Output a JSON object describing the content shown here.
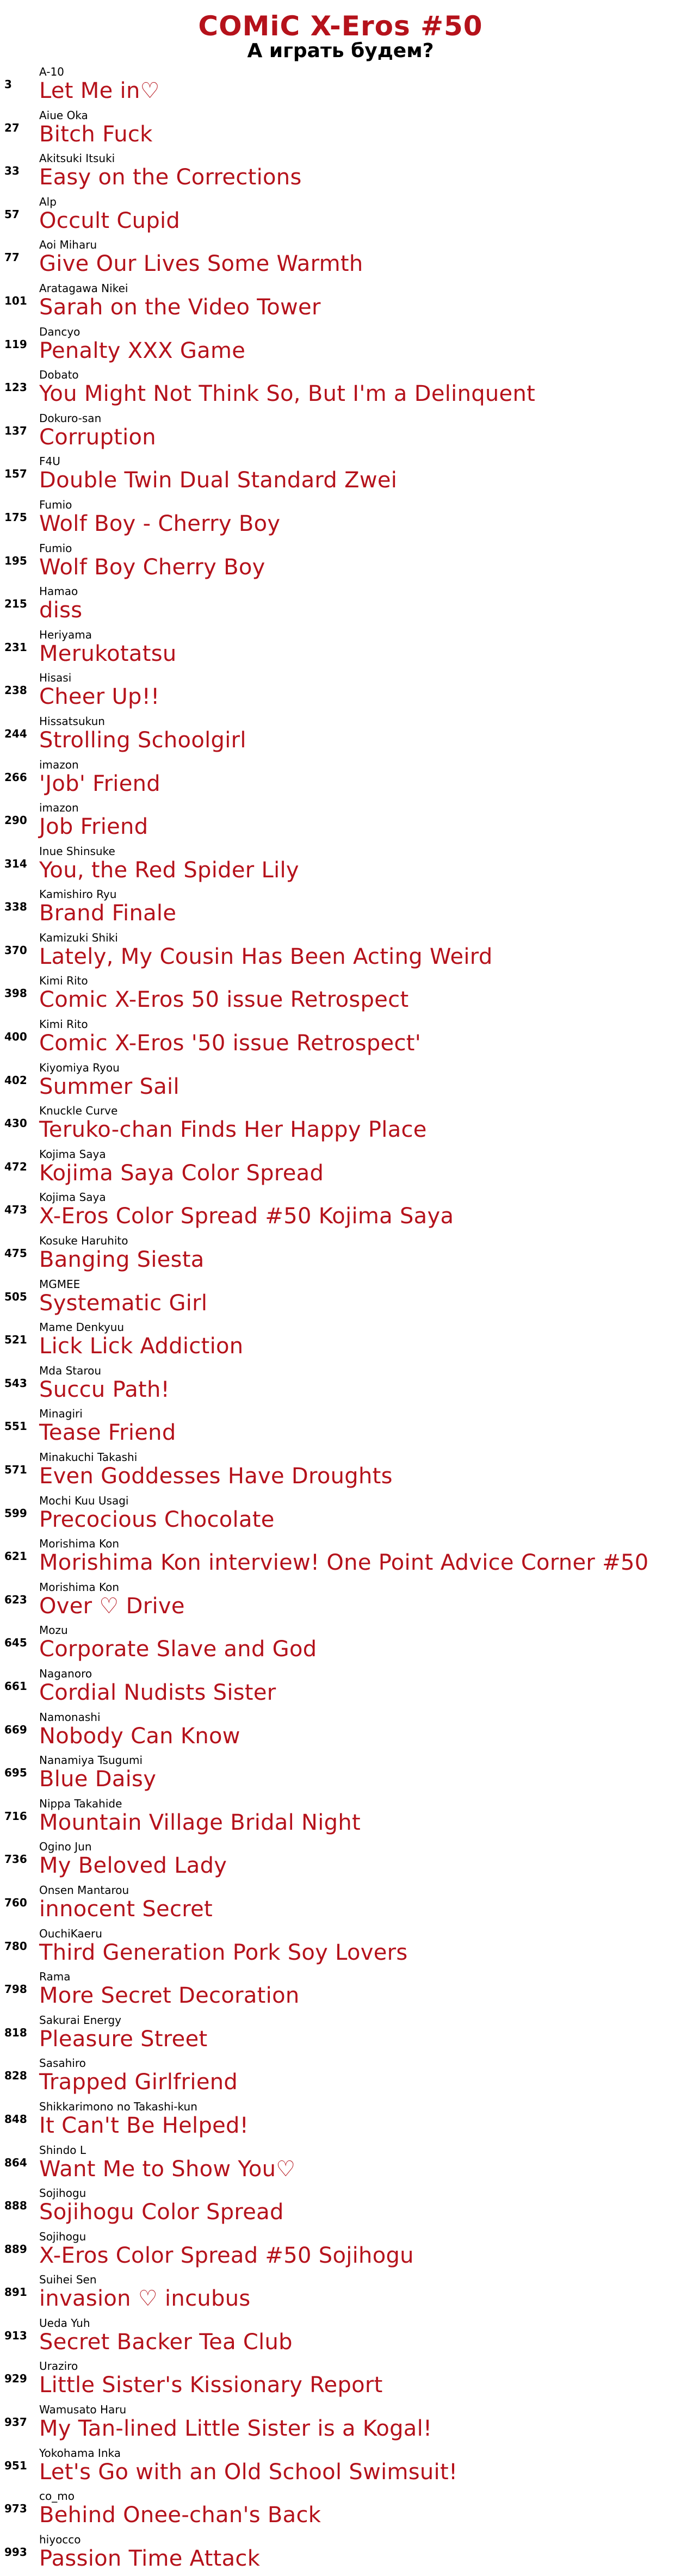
{
  "header": {
    "title": "COMiC X-Eros #50",
    "subtitle": "А играть будем?"
  },
  "colors": {
    "accent": "#b5121b",
    "text": "#000000",
    "background": "#ffffff"
  },
  "entries": [
    {
      "page": "3",
      "author": "A-10",
      "title": "Let Me in♡"
    },
    {
      "page": "27",
      "author": "Aiue Oka",
      "title": "Bitch Fuck"
    },
    {
      "page": "33",
      "author": "Akitsuki Itsuki",
      "title": "Easy on the Corrections"
    },
    {
      "page": "57",
      "author": "Alp",
      "title": "Occult Cupid"
    },
    {
      "page": "77",
      "author": "Aoi Miharu",
      "title": "Give Our Lives Some Warmth"
    },
    {
      "page": "101",
      "author": "Aratagawa Nikei",
      "title": "Sarah on the Video Tower"
    },
    {
      "page": "119",
      "author": "Dancyo",
      "title": "Penalty XXX Game"
    },
    {
      "page": "123",
      "author": "Dobato",
      "title": "You Might Not Think So, But I'm a Delinquent"
    },
    {
      "page": "137",
      "author": "Dokuro-san",
      "title": "Corruption"
    },
    {
      "page": "157",
      "author": "F4U",
      "title": "Double Twin Dual Standard Zwei"
    },
    {
      "page": "175",
      "author": "Fumio",
      "title": "Wolf Boy - Cherry Boy"
    },
    {
      "page": "195",
      "author": "Fumio",
      "title": "Wolf Boy Cherry Boy"
    },
    {
      "page": "215",
      "author": "Hamao",
      "title": "diss"
    },
    {
      "page": "231",
      "author": "Heriyama",
      "title": "Merukotatsu"
    },
    {
      "page": "238",
      "author": "Hisasi",
      "title": "Cheer Up!!"
    },
    {
      "page": "244",
      "author": "Hissatsukun",
      "title": "Strolling Schoolgirl"
    },
    {
      "page": "266",
      "author": "imazon",
      "title": "'Job' Friend"
    },
    {
      "page": "290",
      "author": "imazon",
      "title": "Job Friend"
    },
    {
      "page": "314",
      "author": "Inue Shinsuke",
      "title": "You, the Red Spider Lily"
    },
    {
      "page": "338",
      "author": "Kamishiro Ryu",
      "title": "Brand Finale"
    },
    {
      "page": "370",
      "author": "Kamizuki Shiki",
      "title": "Lately, My Cousin Has Been Acting Weird"
    },
    {
      "page": "398",
      "author": "Kimi Rito",
      "title": "Comic X-Eros 50 issue Retrospect"
    },
    {
      "page": "400",
      "author": "Kimi Rito",
      "title": "Comic X-Eros '50 issue Retrospect'"
    },
    {
      "page": "402",
      "author": "Kiyomiya Ryou",
      "title": "Summer Sail"
    },
    {
      "page": "430",
      "author": "Knuckle Curve",
      "title": "Teruko-chan Finds Her Happy Place"
    },
    {
      "page": "472",
      "author": "Kojima Saya",
      "title": "Kojima Saya Color Spread"
    },
    {
      "page": "473",
      "author": "Kojima Saya",
      "title": "X-Eros Color Spread #50 Kojima Saya"
    },
    {
      "page": "475",
      "author": "Kosuke Haruhito",
      "title": "Banging Siesta"
    },
    {
      "page": "505",
      "author": "MGMEE",
      "title": "Systematic Girl"
    },
    {
      "page": "521",
      "author": "Mame Denkyuu",
      "title": "Lick Lick Addiction"
    },
    {
      "page": "543",
      "author": "Mda Starou",
      "title": "Succu Path!"
    },
    {
      "page": "551",
      "author": "Minagiri",
      "title": "Tease Friend"
    },
    {
      "page": "571",
      "author": "Minakuchi Takashi",
      "title": "Even Goddesses Have Droughts"
    },
    {
      "page": "599",
      "author": "Mochi Kuu Usagi",
      "title": "Precocious Chocolate"
    },
    {
      "page": "621",
      "author": "Morishima Kon",
      "title": "Morishima Kon interview! One Point Advice Corner #50"
    },
    {
      "page": "623",
      "author": "Morishima Kon",
      "title": "Over ♡ Drive"
    },
    {
      "page": "645",
      "author": "Mozu",
      "title": "Corporate Slave and God"
    },
    {
      "page": "661",
      "author": "Naganoro",
      "title": "Cordial Nudists Sister"
    },
    {
      "page": "669",
      "author": "Namonashi",
      "title": "Nobody Can Know"
    },
    {
      "page": "695",
      "author": "Nanamiya Tsugumi",
      "title": "Blue Daisy"
    },
    {
      "page": "716",
      "author": "Nippa Takahide",
      "title": "Mountain Village Bridal Night"
    },
    {
      "page": "736",
      "author": "Ogino Jun",
      "title": "My Beloved Lady"
    },
    {
      "page": "760",
      "author": "Onsen Mantarou",
      "title": "innocent Secret"
    },
    {
      "page": "780",
      "author": "OuchiKaeru",
      "title": "Third Generation Pork Soy Lovers"
    },
    {
      "page": "798",
      "author": "Rama",
      "title": "More Secret Decoration"
    },
    {
      "page": "818",
      "author": "Sakurai Energy",
      "title": "Pleasure Street"
    },
    {
      "page": "828",
      "author": "Sasahiro",
      "title": "Trapped Girlfriend"
    },
    {
      "page": "848",
      "author": "Shikkarimono no Takashi-kun",
      "title": "It Can't Be Helped!"
    },
    {
      "page": "864",
      "author": "Shindo L",
      "title": "Want Me to Show You♡"
    },
    {
      "page": "888",
      "author": "Sojihogu",
      "title": "Sojihogu Color Spread"
    },
    {
      "page": "889",
      "author": "Sojihogu",
      "title": "X-Eros Color Spread #50 Sojihogu"
    },
    {
      "page": "891",
      "author": "Suihei Sen",
      "title": "invasion ♡ incubus"
    },
    {
      "page": "913",
      "author": "Ueda Yuh",
      "title": "Secret Backer Tea Club"
    },
    {
      "page": "929",
      "author": "Uraziro",
      "title": "Little Sister's Kissionary Report"
    },
    {
      "page": "937",
      "author": "Wamusato Haru",
      "title": "My Tan-lined Little Sister is a Kogal!"
    },
    {
      "page": "951",
      "author": "Yokohama Inka",
      "title": "Let's Go with an Old School Swimsuit!"
    },
    {
      "page": "973",
      "author": "co_mo",
      "title": "Behind Onee-chan's Back"
    },
    {
      "page": "993",
      "author": "hiyocco",
      "title": "Passion Time Attack"
    }
  ]
}
